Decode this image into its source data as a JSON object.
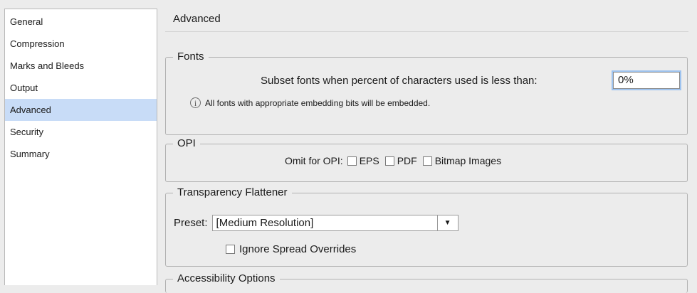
{
  "sidebar": {
    "items": [
      {
        "label": "General",
        "selected": false
      },
      {
        "label": "Compression",
        "selected": false
      },
      {
        "label": "Marks and Bleeds",
        "selected": false
      },
      {
        "label": "Output",
        "selected": false
      },
      {
        "label": "Advanced",
        "selected": true
      },
      {
        "label": "Security",
        "selected": false
      },
      {
        "label": "Summary",
        "selected": false
      }
    ]
  },
  "main": {
    "title": "Advanced",
    "fonts": {
      "legend": "Fonts",
      "subset_label": "Subset fonts when percent of characters used is less than:",
      "subset_value": "0%",
      "info_text": "All fonts with appropriate embedding bits will be embedded.",
      "info_icon": "info-icon"
    },
    "opi": {
      "legend": "OPI",
      "omit_label": "Omit for OPI:",
      "options": [
        {
          "label": "EPS",
          "checked": false
        },
        {
          "label": "PDF",
          "checked": false
        },
        {
          "label": "Bitmap Images",
          "checked": false
        }
      ]
    },
    "flattener": {
      "legend": "Transparency Flattener",
      "preset_label": "Preset:",
      "preset_value": "[Medium Resolution]",
      "ignore_label": "Ignore Spread Overrides",
      "ignore_checked": false
    },
    "accessibility": {
      "legend": "Accessibility Options"
    }
  },
  "colors": {
    "selection": "#c8dcf7",
    "focus_ring": "#9ec3ef",
    "background": "#ececec"
  }
}
